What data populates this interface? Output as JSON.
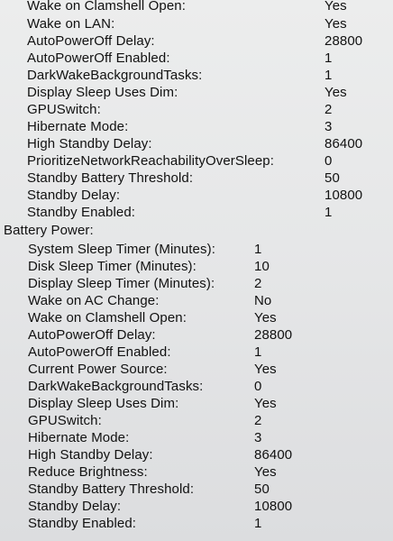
{
  "ac_settings": [
    {
      "key": "Wake on Clamshell Open:",
      "value": "Yes"
    },
    {
      "key": "Wake on LAN:",
      "value": "Yes"
    },
    {
      "key": "AutoPowerOff Delay:",
      "value": "28800"
    },
    {
      "key": "AutoPowerOff Enabled:",
      "value": "1"
    },
    {
      "key": "DarkWakeBackgroundTasks:",
      "value": "1"
    },
    {
      "key": "Display Sleep Uses Dim:",
      "value": "Yes"
    },
    {
      "key": "GPUSwitch:",
      "value": "2"
    },
    {
      "key": "Hibernate Mode:",
      "value": "3"
    },
    {
      "key": "High Standby Delay:",
      "value": "86400"
    },
    {
      "key": "PrioritizeNetworkReachabilityOverSleep:",
      "value": "0"
    },
    {
      "key": "Standby Battery Threshold:",
      "value": "50"
    },
    {
      "key": "Standby Delay:",
      "value": "10800"
    },
    {
      "key": "Standby Enabled:",
      "value": "1"
    }
  ],
  "battery_heading": "Battery Power:",
  "battery_settings": [
    {
      "key": "System Sleep Timer (Minutes):",
      "value": "1"
    },
    {
      "key": "Disk Sleep Timer (Minutes):",
      "value": "10"
    },
    {
      "key": "Display Sleep Timer (Minutes):",
      "value": "2"
    },
    {
      "key": "Wake on AC Change:",
      "value": "No"
    },
    {
      "key": "Wake on Clamshell Open:",
      "value": "Yes"
    },
    {
      "key": "AutoPowerOff Delay:",
      "value": "28800"
    },
    {
      "key": "AutoPowerOff Enabled:",
      "value": "1"
    },
    {
      "key": "Current Power Source:",
      "value": "Yes"
    },
    {
      "key": "DarkWakeBackgroundTasks:",
      "value": "0"
    },
    {
      "key": "Display Sleep Uses Dim:",
      "value": "Yes"
    },
    {
      "key": "GPUSwitch:",
      "value": "2"
    },
    {
      "key": "Hibernate Mode:",
      "value": "3"
    },
    {
      "key": "High Standby Delay:",
      "value": "86400"
    },
    {
      "key": "Reduce Brightness:",
      "value": "Yes"
    },
    {
      "key": "Standby Battery Threshold:",
      "value": "50"
    },
    {
      "key": "Standby Delay:",
      "value": "10800"
    },
    {
      "key": "Standby Enabled:",
      "value": "1"
    }
  ]
}
